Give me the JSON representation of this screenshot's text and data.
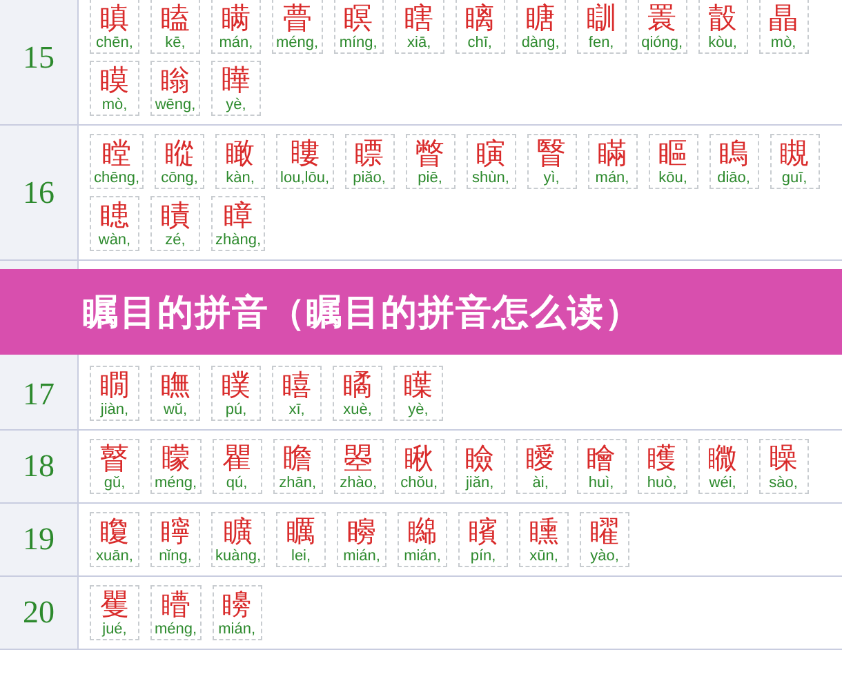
{
  "banner": {
    "title": "瞩目的拼音（瞩目的拼音怎么读）"
  },
  "rows": [
    {
      "strokes": "15",
      "covered": false,
      "chars": [
        {
          "char": "瞋",
          "pinyin": "chēn,"
        },
        {
          "char": "瞌",
          "pinyin": "kē,"
        },
        {
          "char": "瞒",
          "pinyin": "mán,"
        },
        {
          "char": "瞢",
          "pinyin": "méng,"
        },
        {
          "char": "瞑",
          "pinyin": "míng,"
        },
        {
          "char": "瞎",
          "pinyin": "xiā,"
        },
        {
          "char": "瞝",
          "pinyin": "chī,"
        },
        {
          "char": "瞊",
          "pinyin": "dàng,"
        },
        {
          "char": "瞓",
          "pinyin": "fen,"
        },
        {
          "char": "瞏",
          "pinyin": "qióng,"
        },
        {
          "char": "瞉",
          "pinyin": "kòu,"
        },
        {
          "char": "瞐",
          "pinyin": "mò,"
        },
        {
          "char": "瞙",
          "pinyin": "mò,"
        },
        {
          "char": "瞈",
          "pinyin": "wēng,"
        },
        {
          "char": "瞱",
          "pinyin": "yè,"
        }
      ]
    },
    {
      "strokes": "16",
      "covered": false,
      "chars": [
        {
          "char": "瞠",
          "pinyin": "chēng,"
        },
        {
          "char": "瞛",
          "pinyin": "cōng,"
        },
        {
          "char": "瞰",
          "pinyin": "kàn,"
        },
        {
          "char": "瞜",
          "pinyin": "lou,lōu,"
        },
        {
          "char": "瞟",
          "pinyin": "piǎo,"
        },
        {
          "char": "瞥",
          "pinyin": "piē,"
        },
        {
          "char": "瞚",
          "pinyin": "shùn,"
        },
        {
          "char": "瞖",
          "pinyin": "yì,"
        },
        {
          "char": "瞞",
          "pinyin": "mán,"
        },
        {
          "char": "瞘",
          "pinyin": "kōu,"
        },
        {
          "char": "瞗",
          "pinyin": "diāo,"
        },
        {
          "char": "瞡",
          "pinyin": "guī,"
        },
        {
          "char": "瞣",
          "pinyin": "wàn,"
        },
        {
          "char": "瞔",
          "pinyin": "zé,"
        },
        {
          "char": "瞕",
          "pinyin": "zhàng,"
        }
      ]
    },
    {
      "strokes": "17",
      "covered": true,
      "chars": [
        {
          "char": "瞯",
          "pinyin": "jiàn,"
        },
        {
          "char": "瞴",
          "pinyin": "wǔ,"
        },
        {
          "char": "瞨",
          "pinyin": "pú,"
        },
        {
          "char": "瞦",
          "pinyin": "xī,"
        },
        {
          "char": "瞲",
          "pinyin": "xuè,"
        },
        {
          "char": "瞸",
          "pinyin": "yè,"
        }
      ]
    },
    {
      "strokes": "18",
      "covered": false,
      "chars": [
        {
          "char": "瞽",
          "pinyin": "gǔ,"
        },
        {
          "char": "矇",
          "pinyin": "méng,"
        },
        {
          "char": "瞿",
          "pinyin": "qú,"
        },
        {
          "char": "瞻",
          "pinyin": "zhān,"
        },
        {
          "char": "曌",
          "pinyin": "zhào,"
        },
        {
          "char": "瞅",
          "pinyin": "chǒu,"
        },
        {
          "char": "瞼",
          "pinyin": "jiǎn,"
        },
        {
          "char": "瞹",
          "pinyin": "ài,"
        },
        {
          "char": "瞺",
          "pinyin": "huì,"
        },
        {
          "char": "矆",
          "pinyin": "huò,"
        },
        {
          "char": "矀",
          "pinyin": "wéi,"
        },
        {
          "char": "矂",
          "pinyin": "sào,"
        }
      ]
    },
    {
      "strokes": "19",
      "covered": false,
      "chars": [
        {
          "char": "矎",
          "pinyin": "xuān,"
        },
        {
          "char": "矃",
          "pinyin": "nǐng,"
        },
        {
          "char": "矌",
          "pinyin": "kuàng,"
        },
        {
          "char": "矋",
          "pinyin": "lei,"
        },
        {
          "char": "矈",
          "pinyin": "mián,"
        },
        {
          "char": "矊",
          "pinyin": "mián,"
        },
        {
          "char": "矉",
          "pinyin": "pín,"
        },
        {
          "char": "矄",
          "pinyin": "xūn,"
        },
        {
          "char": "矅",
          "pinyin": "yào,"
        }
      ]
    },
    {
      "strokes": "20",
      "covered": false,
      "chars": [
        {
          "char": "矍",
          "pinyin": "jué,"
        },
        {
          "char": "矒",
          "pinyin": "méng,"
        },
        {
          "char": "矏",
          "pinyin": "mián,"
        }
      ]
    }
  ]
}
